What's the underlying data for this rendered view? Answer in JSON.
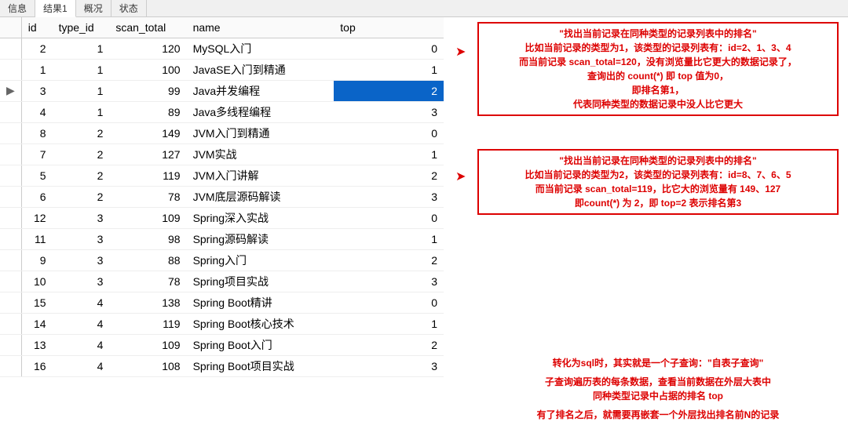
{
  "tabs": {
    "t0": "信息",
    "t1": "结果1",
    "t2": "概况",
    "t3": "状态"
  },
  "headers": {
    "id": "id",
    "type_id": "type_id",
    "scan_total": "scan_total",
    "name": "name",
    "top": "top"
  },
  "rows": [
    {
      "id": "2",
      "type_id": "1",
      "scan_total": "120",
      "name": "MySQL入门",
      "top": "0"
    },
    {
      "id": "1",
      "type_id": "1",
      "scan_total": "100",
      "name": "JavaSE入门到精通",
      "top": "1"
    },
    {
      "id": "3",
      "type_id": "1",
      "scan_total": "99",
      "name": "Java并发编程",
      "top": "2"
    },
    {
      "id": "4",
      "type_id": "1",
      "scan_total": "89",
      "name": "Java多线程编程",
      "top": "3"
    },
    {
      "id": "8",
      "type_id": "2",
      "scan_total": "149",
      "name": "JVM入门到精通",
      "top": "0"
    },
    {
      "id": "7",
      "type_id": "2",
      "scan_total": "127",
      "name": "JVM实战",
      "top": "1"
    },
    {
      "id": "5",
      "type_id": "2",
      "scan_total": "119",
      "name": "JVM入门讲解",
      "top": "2"
    },
    {
      "id": "6",
      "type_id": "2",
      "scan_total": "78",
      "name": "JVM底层源码解读",
      "top": "3"
    },
    {
      "id": "12",
      "type_id": "3",
      "scan_total": "109",
      "name": "Spring深入实战",
      "top": "0"
    },
    {
      "id": "11",
      "type_id": "3",
      "scan_total": "98",
      "name": "Spring源码解读",
      "top": "1"
    },
    {
      "id": "9",
      "type_id": "3",
      "scan_total": "88",
      "name": "Spring入门",
      "top": "2"
    },
    {
      "id": "10",
      "type_id": "3",
      "scan_total": "78",
      "name": "Spring项目实战",
      "top": "3"
    },
    {
      "id": "15",
      "type_id": "4",
      "scan_total": "138",
      "name": "Spring Boot精讲",
      "top": "0"
    },
    {
      "id": "14",
      "type_id": "4",
      "scan_total": "119",
      "name": "Spring Boot核心技术",
      "top": "1"
    },
    {
      "id": "13",
      "type_id": "4",
      "scan_total": "109",
      "name": "Spring Boot入门",
      "top": "2"
    },
    {
      "id": "16",
      "type_id": "4",
      "scan_total": "108",
      "name": "Spring Boot项目实战",
      "top": "3"
    }
  ],
  "selected_index": 2,
  "note1": {
    "l1": "\"找出当前记录在同种类型的记录列表中的排名\"",
    "l2": "比如当前记录的类型为1，该类型的记录列表有：id=2、1、3、4",
    "l3": "而当前记录 scan_total=120，没有浏览量比它更大的数据记录了，",
    "l4": "查询出的 count(*) 即 top 值为0，",
    "l5": "即排名第1，",
    "l6": "代表同种类型的数据记录中没人比它更大"
  },
  "note2": {
    "l1": "\"找出当前记录在同种类型的记录列表中的排名\"",
    "l2": "比如当前记录的类型为2，该类型的记录列表有：id=8、7、6、5",
    "l3": "而当前记录 scan_total=119，比它大的浏览量有 149、127",
    "l4": "即count(*) 为 2，即 top=2 表示排名第3"
  },
  "note3": {
    "l1": "转化为sql时，其实就是一个子查询：\"自表子查询\"",
    "l2": "子查询遍历表的每条数据，查看当前数据在外层大表中",
    "l3": "同种类型记录中占据的排名 top",
    "l4": "有了排名之后，就需要再嵌套一个外层找出排名前N的记录"
  }
}
